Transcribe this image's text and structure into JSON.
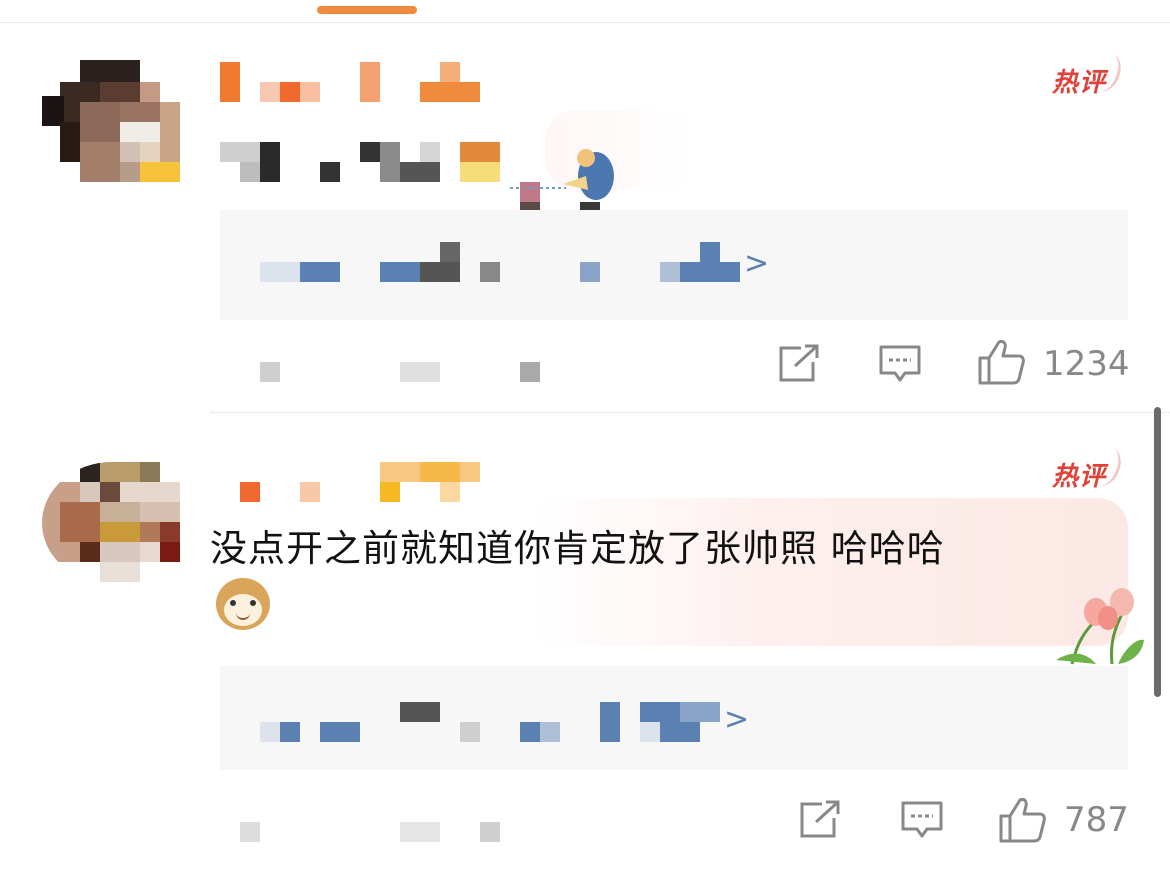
{
  "hot_badge_label": "热评",
  "comments": [
    {
      "text": "",
      "reply_chevron": ">",
      "like_count": "1234"
    },
    {
      "text": "没点开之前就知道你肯定放了张帅照 哈哈哈",
      "reply_chevron": ">",
      "like_count": "787"
    }
  ],
  "icons": {
    "share": "share-icon",
    "comment": "comment-icon",
    "like": "thumbs-up-icon"
  },
  "colors": {
    "accent": "#f08a3c",
    "hot_badge": "#e0423a",
    "link": "#5b80b2"
  }
}
